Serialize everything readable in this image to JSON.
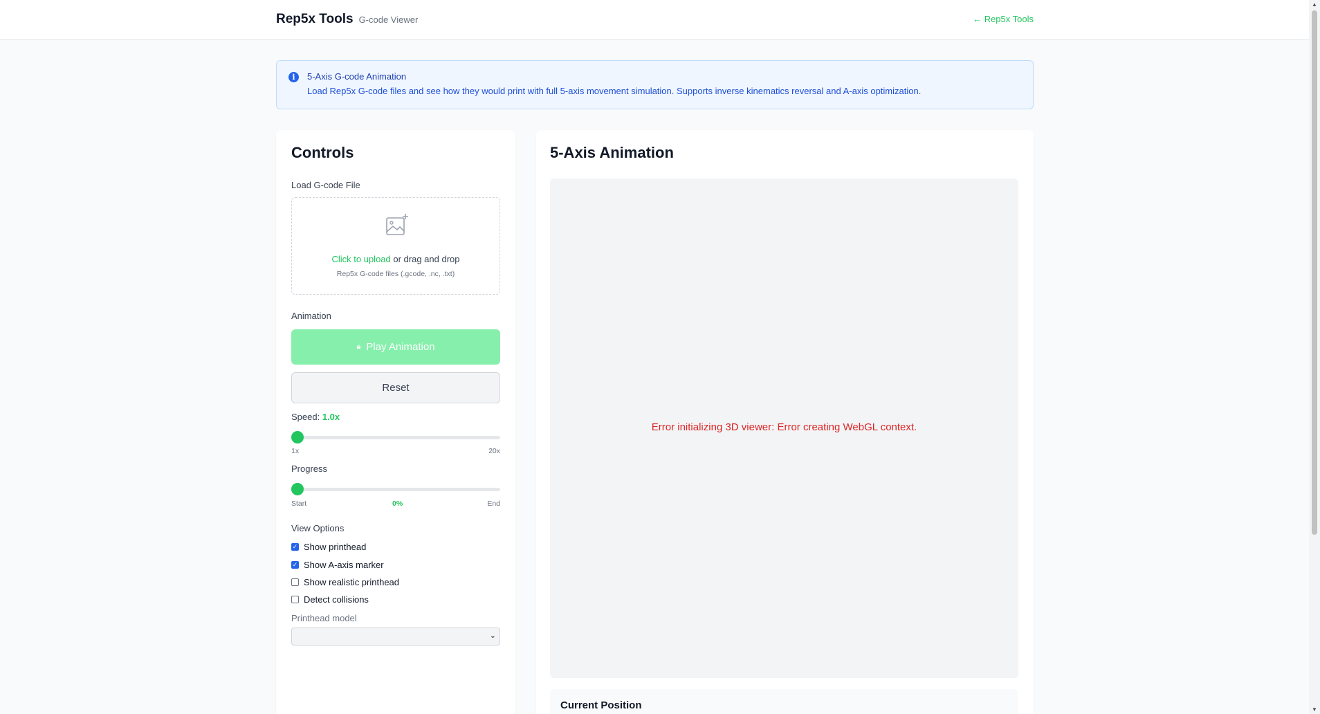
{
  "header": {
    "brand": "Rep5x Tools",
    "subtitle": "G-code Viewer",
    "back_link": "← Rep5x Tools"
  },
  "info": {
    "icon": "info-icon",
    "title": "5-Axis G-code Animation",
    "text": "Load Rep5x G-code files and see how they would print with full 5-axis movement simulation. Supports inverse kinematics reversal and A-axis optimization."
  },
  "controls": {
    "title": "Controls",
    "load_label": "Load G-code File",
    "dropzone": {
      "icon": "image-add-icon",
      "link": "Click to upload",
      "rest": " or drag and drop",
      "hint": "Rep5x G-code files (.gcode, .nc, .txt)"
    },
    "animation_label": "Animation",
    "play_label": "Play Animation",
    "reset_label": "Reset",
    "speed": {
      "label": "Speed: ",
      "value": "1.0x",
      "level": 0,
      "min_label": "1x",
      "max_label": "20x"
    },
    "progress": {
      "label": "Progress",
      "level": 0,
      "start_label": "Start",
      "percent": "0%",
      "end_label": "End"
    },
    "view_options_label": "View Options",
    "options": [
      {
        "label": "Show printhead",
        "checked": true
      },
      {
        "label": "Show A-axis marker",
        "checked": true
      },
      {
        "label": "Show realistic printhead",
        "checked": false
      },
      {
        "label": "Detect collisions",
        "checked": false
      }
    ],
    "printhead_model_label": "Printhead model",
    "printhead_model_value": ""
  },
  "animation_panel": {
    "title": "5-Axis Animation",
    "error": "Error initializing 3D viewer: Error creating WebGL context.",
    "position_title": "Current Position"
  },
  "colors": {
    "accent": "#22c55e",
    "info_bg": "#eff6ff",
    "error": "#dc2626"
  }
}
